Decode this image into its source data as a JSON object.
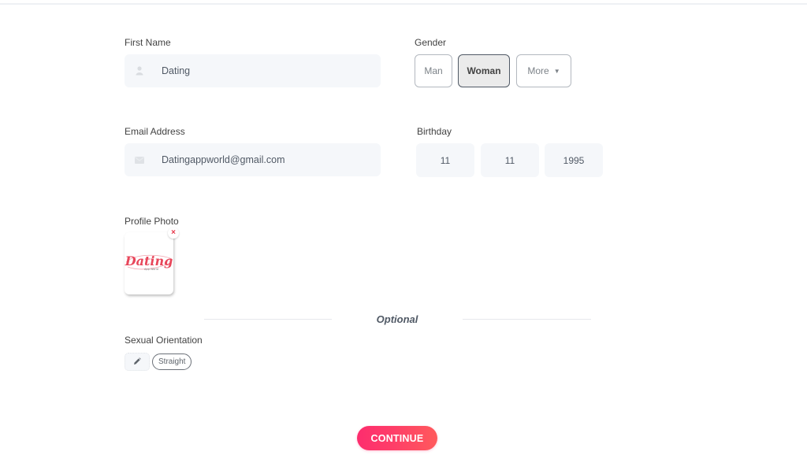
{
  "form": {
    "first_name": {
      "label": "First Name",
      "value": "Dating",
      "icon": "person-icon"
    },
    "gender": {
      "label": "Gender",
      "options": [
        "Man",
        "Woman",
        "More"
      ],
      "selected": "Woman",
      "more_caret": "▼"
    },
    "email": {
      "label": "Email Address",
      "value": "Datingappworld@gmail.com",
      "icon": "envelope-icon"
    },
    "birthday": {
      "label": "Birthday",
      "month": "11",
      "day": "11",
      "year": "1995"
    },
    "profile_photo": {
      "label": "Profile Photo",
      "image_text": "Dating",
      "image_subtext": "App World",
      "remove_glyph": "×"
    },
    "optional_section": {
      "title": "Optional"
    },
    "sexual_orientation": {
      "label": "Sexual Orientation",
      "selected_chip": "Straight",
      "edit_icon": "pencil-icon"
    },
    "continue_label": "CONTINUE"
  },
  "colors": {
    "accent_start": "#fd2d6e",
    "accent_end": "#ff5a5c",
    "field_bg": "#f5f7fa",
    "remove_red": "#e6374a"
  }
}
